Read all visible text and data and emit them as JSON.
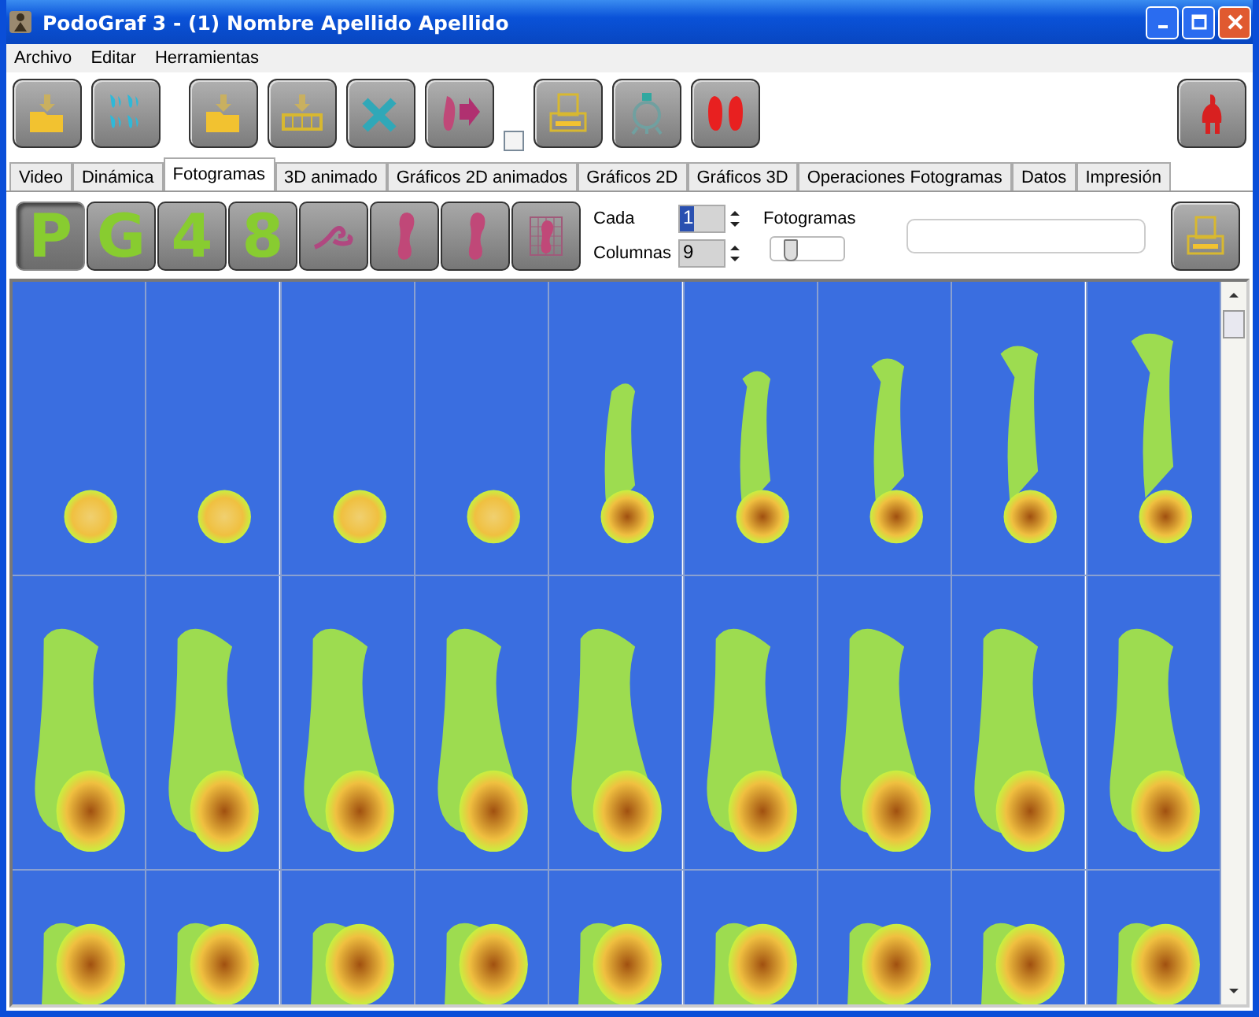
{
  "window": {
    "title": "PodoGraf 3 - (1) Nombre Apellido Apellido"
  },
  "menu": [
    "Archivo",
    "Editar",
    "Herramientas"
  ],
  "toolbar": {
    "option_checked": false
  },
  "tabs": [
    {
      "label": "Video",
      "selected": false
    },
    {
      "label": "Dinámica",
      "selected": false
    },
    {
      "label": "Fotogramas",
      "selected": true
    },
    {
      "label": "3D animado",
      "selected": false
    },
    {
      "label": "Gráficos 2D animados",
      "selected": false
    },
    {
      "label": "Gráficos 2D",
      "selected": false
    },
    {
      "label": "Gráficos 3D",
      "selected": false
    },
    {
      "label": "Operaciones Fotogramas",
      "selected": false
    },
    {
      "label": "Datos",
      "selected": false
    },
    {
      "label": "Impresión",
      "selected": false
    }
  ],
  "view_buttons": [
    {
      "kind": "letter",
      "label": "P",
      "selected": true
    },
    {
      "kind": "letter",
      "label": "G",
      "selected": false
    },
    {
      "kind": "letter",
      "label": "4",
      "selected": false
    },
    {
      "kind": "letter",
      "label": "8",
      "selected": false
    },
    {
      "kind": "cut",
      "selected": false
    },
    {
      "kind": "foot",
      "selected": false
    },
    {
      "kind": "foot",
      "selected": false
    },
    {
      "kind": "grid",
      "selected": false
    }
  ],
  "cada": {
    "label": "Cada",
    "value": "1"
  },
  "columnas": {
    "label": "Columnas",
    "value": "9"
  },
  "fotogramas": {
    "label": "Fotogramas",
    "level": 0.2
  }
}
